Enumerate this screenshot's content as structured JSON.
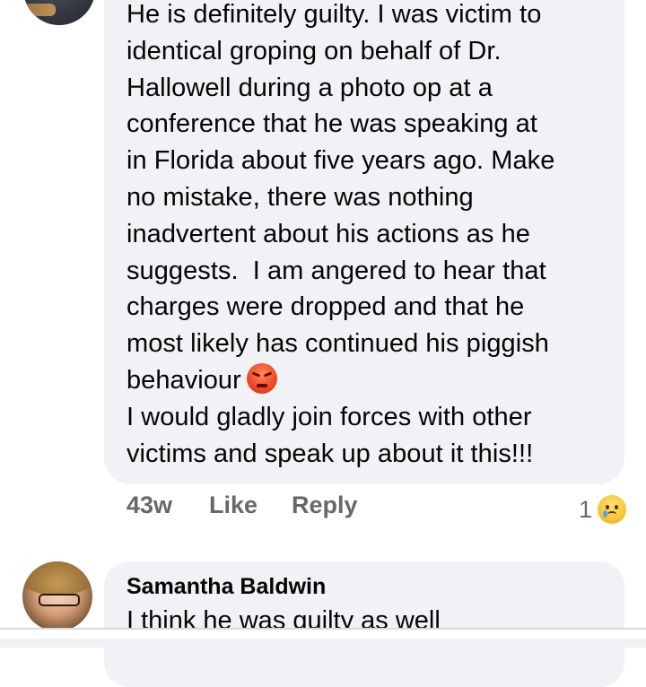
{
  "comment_1": {
    "text": "He is definitely guilty. I was victim to\nidentical groping on behalf of Dr.\nHallowell during a photo op at a\nconference that he was speaking at\nin Florida about five years ago. Make\nno mistake, there was nothing\ninadvertent about his actions as he\nsuggests.  I am angered to hear that\ncharges were dropped and that he\nmost likely has continued his piggish\nbehaviour",
    "text_after_emoji": "I would gladly join forces with other\nvictims and speak up about it this!!!",
    "inline_emoji": "angry-face-icon",
    "timestamp": "43w",
    "like_label": "Like",
    "reply_label": "Reply",
    "reaction_count": "1",
    "reaction_icon": "sad-tear-face-icon"
  },
  "comment_2": {
    "author": "Samantha Baldwin",
    "text": "I think he was guilty as well"
  },
  "colors": {
    "bubble": "#f0f2f5",
    "meta_text": "#65676b",
    "primary_text": "#050505"
  }
}
